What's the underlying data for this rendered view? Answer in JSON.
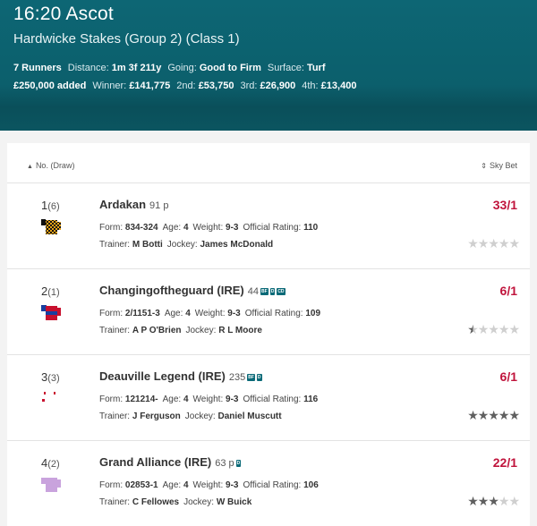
{
  "race": {
    "title": "16:20 Ascot",
    "subtitle": "Hardwicke Stakes (Group 2) (Class 1)",
    "runners_count": "7 Runners",
    "distance_label": "Distance:",
    "distance": "1m 3f 211y",
    "going_label": "Going:",
    "going": "Good to Firm",
    "surface_label": "Surface:",
    "surface": "Turf",
    "added": "£250,000 added",
    "winner_label": "Winner:",
    "winner": "£141,775",
    "second_label": "2nd:",
    "second": "£53,750",
    "third_label": "3rd:",
    "third": "£26,900",
    "fourth_label": "4th:",
    "fourth": "£13,400"
  },
  "sort": {
    "left_label": "No. (Draw)",
    "right_label": "Sky Bet",
    "icon": "sort-arrows-icon"
  },
  "labels": {
    "form": "Form:",
    "age": "Age:",
    "weight": "Weight:",
    "official_rating": "Official Rating:",
    "trainer": "Trainer:",
    "jockey": "Jockey:"
  },
  "runners": [
    {
      "number": "1",
      "draw": "(6)",
      "name": "Ardakan",
      "rating": "91 p",
      "badges": [],
      "form": "834-324",
      "age": "4",
      "weight": "9-3",
      "official_rating": "110",
      "trainer": "M Botti",
      "jockey": "James McDonald",
      "odds": "33/1",
      "stars": 0,
      "silks": "checked-silks-icon"
    },
    {
      "number": "2",
      "draw": "(1)",
      "name": "Changingoftheguard (IRE)",
      "rating": "44",
      "badges": [
        "BF",
        "D",
        "CD"
      ],
      "form": "2/1151-3",
      "age": "4",
      "weight": "9-3",
      "official_rating": "109",
      "trainer": "A P O'Brien",
      "jockey": "R L Moore",
      "odds": "6/1",
      "stars": 0.5,
      "silks": "red-blue-silks-icon"
    },
    {
      "number": "3",
      "draw": "(3)",
      "name": "Deauville Legend (IRE)",
      "rating": "235",
      "badges": [
        "BF",
        "D"
      ],
      "form": "121214-",
      "age": "4",
      "weight": "9-3",
      "official_rating": "116",
      "trainer": "J Ferguson",
      "jockey": "Daniel Muscutt",
      "odds": "6/1",
      "stars": 5,
      "silks": "white-red-silks-icon"
    },
    {
      "number": "4",
      "draw": "(2)",
      "name": "Grand Alliance (IRE)",
      "rating": "63 p",
      "badges": [
        "D"
      ],
      "form": "02853-1",
      "age": "4",
      "weight": "9-3",
      "official_rating": "106",
      "trainer": "C Fellowes",
      "jockey": "W Buick",
      "odds": "22/1",
      "stars": 3,
      "silks": "lilac-silks-icon"
    }
  ],
  "colors": {
    "header": "#0c5f6c",
    "odds": "#c0143c",
    "badge": "#0b6a78"
  }
}
